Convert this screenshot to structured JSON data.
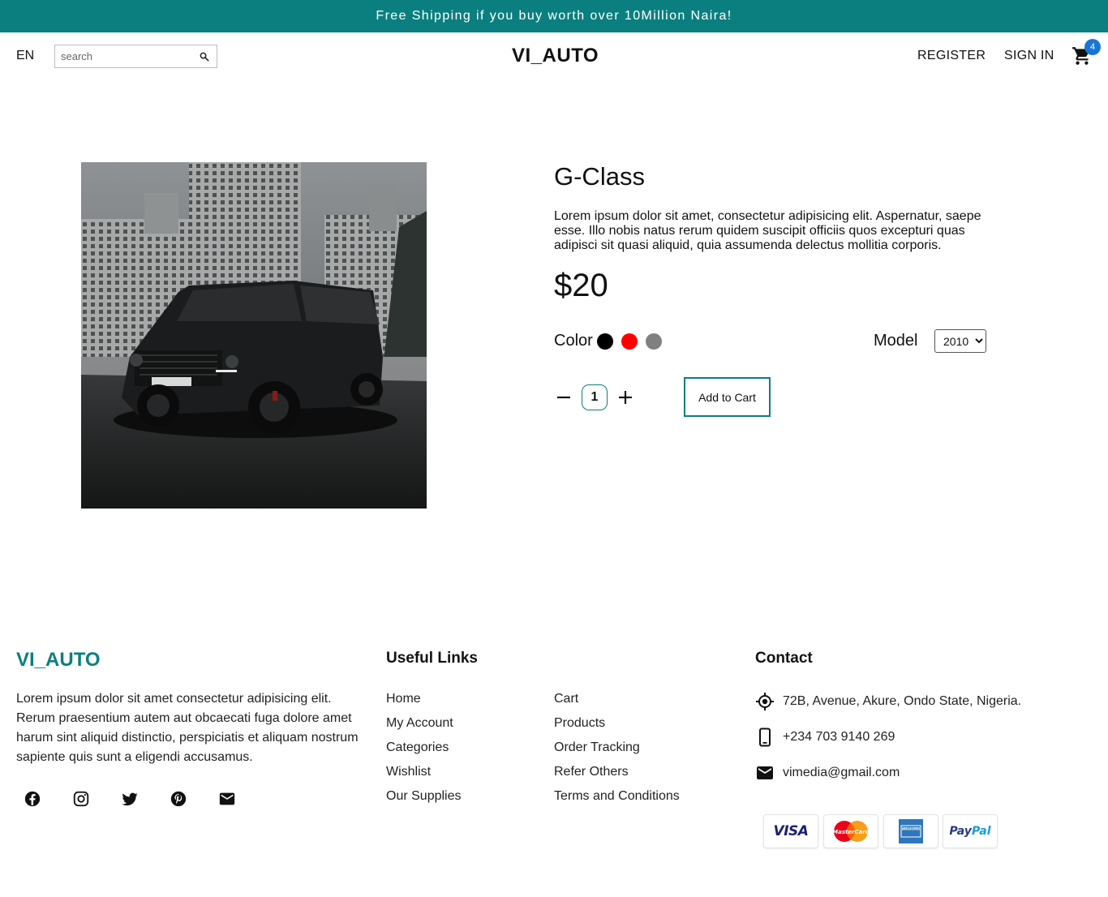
{
  "announcement": "Free Shipping if you buy worth over 10Million Naira!",
  "header": {
    "language": "EN",
    "search_placeholder": "search",
    "logo": "VI_AUTO",
    "register": "REGISTER",
    "sign_in": "SIGN IN",
    "cart_count": "4",
    "accent_color": "#0b7f7f"
  },
  "product": {
    "title": "G-Class",
    "description": "Lorem ipsum dolor sit amet, consectetur adipisicing elit. Aspernatur, saepe esse. Illo nobis natus rerum quidem suscipit officiis quos excepturi quas adipisci sit quasi aliquid, quia assumenda delectus mollitia corporis.",
    "price": "$20",
    "color_label": "Color",
    "colors": [
      "#000000",
      "#ff0000",
      "#808080"
    ],
    "model_label": "Model",
    "model_selected": "2010",
    "quantity": "1",
    "add_to_cart": "Add to Cart"
  },
  "footer": {
    "logo": "VI_AUTO",
    "description": "Lorem ipsum dolor sit amet consectetur adipisicing elit. Rerum praesentium autem aut obcaecati fuga dolore amet harum sint aliquid distinctio, perspiciatis et aliquam nostrum sapiente quis sunt a eligendi accusamus.",
    "social_icons": [
      "facebook-icon",
      "instagram-icon",
      "twitter-icon",
      "pinterest-icon",
      "mail-icon"
    ],
    "useful_links_title": "Useful Links",
    "links_col1": [
      "Home",
      "My Account",
      "Categories",
      "Wishlist",
      "Our Supplies"
    ],
    "links_col2": [
      "Cart",
      "Products",
      "Order Tracking",
      "Refer Others",
      "Terms and Conditions"
    ],
    "contact_title": "Contact",
    "address": "72B, Avenue, Akure, Ondo State, Nigeria.",
    "phone": "+234 703 9140 269",
    "email": "vimedia@gmail.com",
    "payments": {
      "visa": "VISA",
      "mastercard": "MasterCard",
      "amex": "AMERICAN EXPRESS",
      "paypal_1": "Pay",
      "paypal_2": "Pal"
    }
  }
}
